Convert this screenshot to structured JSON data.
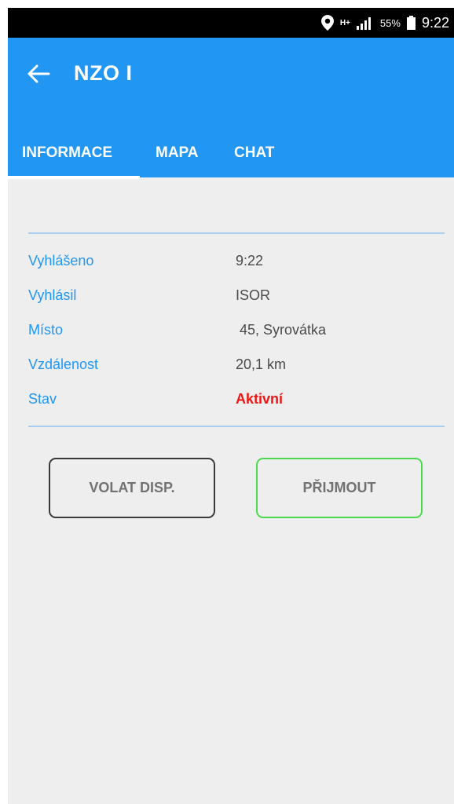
{
  "status_bar": {
    "location_icon": "map-pin-icon",
    "network_type": "H+",
    "signal_icon": "signal-bars-icon",
    "battery_percent": "55%",
    "battery_icon": "battery-icon",
    "time": "9:22"
  },
  "app_bar": {
    "back_icon": "arrow-left-icon",
    "title": "NZO I",
    "color": "#2196f3"
  },
  "tabs": [
    {
      "label": "INFORMACE",
      "selected": true
    },
    {
      "label": "MAPA",
      "selected": false
    },
    {
      "label": "CHAT",
      "selected": false
    }
  ],
  "info": {
    "rows": [
      {
        "label": "Vyhlášeno",
        "value": "9:22"
      },
      {
        "label": "Vyhlásil",
        "value": "ISOR"
      },
      {
        "label": "Místo",
        "value": " 45, Syrovátka"
      },
      {
        "label": "Vzdálenost",
        "value": "20,1 km"
      },
      {
        "label": "Stav",
        "value": "Aktivní"
      }
    ],
    "status_color": "#f01414",
    "label_color": "#2196f3"
  },
  "buttons": {
    "dispatch_label": "VOLAT DISP.",
    "accept_label": "PŘIJMOUT",
    "accept_border_color": "#4cd94c"
  }
}
